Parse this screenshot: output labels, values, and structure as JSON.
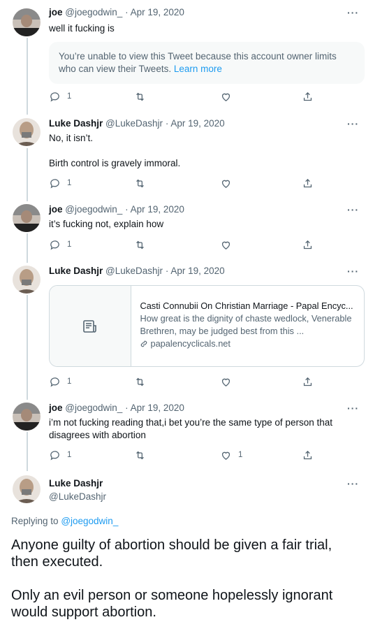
{
  "tweets": [
    {
      "name": "joe",
      "handle": "@joegodwin_",
      "date": "Apr 19, 2020",
      "text": "well it fucking is",
      "reply_count": "1"
    },
    {
      "name": "Luke Dashjr",
      "handle": "@LukeDashjr",
      "date": "Apr 19, 2020",
      "text_lines": [
        "No, it isn’t.",
        "Birth control is gravely immoral."
      ],
      "reply_count": "1"
    },
    {
      "name": "joe",
      "handle": "@joegodwin_",
      "date": "Apr 19, 2020",
      "text": "it’s fucking not, explain how",
      "reply_count": "1"
    },
    {
      "name": "Luke Dashjr",
      "handle": "@LukeDashjr",
      "date": "Apr 19, 2020",
      "reply_count": "1"
    },
    {
      "name": "joe",
      "handle": "@joegodwin_",
      "date": "Apr 19, 2020",
      "text": "i’m not fucking reading that,i bet you’re the same type of person that disagrees with abortion",
      "reply_count": "1",
      "like_count": "1"
    }
  ],
  "dot": "·",
  "more": "···",
  "notice": {
    "text": "You’re unable to view this Tweet because this account owner limits who can view their Tweets.",
    "link": "Learn more"
  },
  "card": {
    "title": "Casti Connubii On Christian Marriage - Papal Encyc...",
    "description": "How great is the dignity of chaste wedlock, Venerable Brethren, may be judged best from this ...",
    "domain": "papalencyclicals.net"
  },
  "main_tweet": {
    "name": "Luke Dashjr",
    "handle": "@LukeDashjr",
    "replying_prefix": "Replying to",
    "replying_handle": "@joegodwin_",
    "paragraphs": [
      "Anyone guilty of abortion should be given a fair trial, then executed.",
      "Only an evil person or someone hopelessly ignorant would support abortion."
    ]
  },
  "icons": {
    "reply": "reply-icon",
    "retweet": "retweet-icon",
    "like": "heart-icon",
    "share": "share-icon",
    "article": "article-icon",
    "link": "link-icon"
  },
  "colors": {
    "text": "#0f1419",
    "secondary": "#536471",
    "accent": "#1d9bf0",
    "border": "#cfd9de",
    "notice_bg": "#f7f9f9"
  }
}
